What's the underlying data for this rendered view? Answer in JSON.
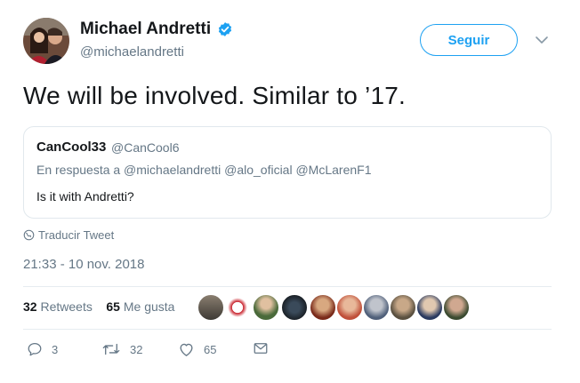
{
  "author": {
    "name": "Michael Andretti",
    "handle": "@michaelandretti",
    "verified": true
  },
  "follow_button": {
    "label": "Seguir"
  },
  "tweet": {
    "text": "We will be involved. Similar to ’17."
  },
  "quoted_tweet": {
    "name": "CanCool33",
    "handle": "@CanCool6",
    "reply_to": "En respuesta a @michaelandretti @alo_oficial @McLarenF1",
    "text": "Is it with Andretti?"
  },
  "translate": {
    "label": "Traducir Tweet"
  },
  "timestamp": "21:33 - 10 nov. 2018",
  "stats": {
    "retweets_count": "32",
    "retweets_label": "Retweets",
    "likes_count": "65",
    "likes_label": "Me gusta"
  },
  "actions": {
    "reply_count": "3",
    "retweet_count": "32",
    "like_count": "65"
  },
  "colors": {
    "accent": "#1da1f2",
    "text": "#14171a",
    "muted": "#657786",
    "border": "#e1e8ed"
  },
  "icons": [
    "verified-badge-icon",
    "chevron-down-icon",
    "globe-icon",
    "reply-icon",
    "retweet-icon",
    "heart-icon",
    "message-icon"
  ]
}
